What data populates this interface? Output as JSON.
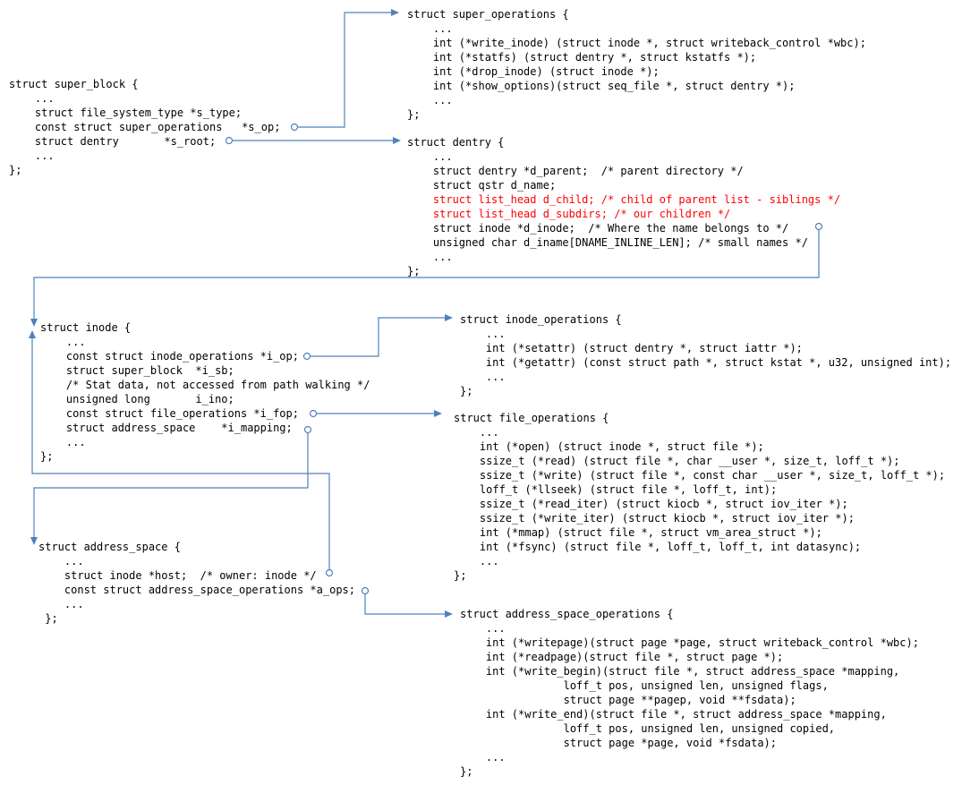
{
  "diagram": {
    "blocks": [
      {
        "id": "super_block",
        "lines": [
          {
            "text": "struct super_block {"
          },
          {
            "text": "    ..."
          },
          {
            "text": "    struct file_system_type *s_type;"
          },
          {
            "text": "    const struct super_operations   *s_op;"
          },
          {
            "text": "    struct dentry       *s_root;"
          },
          {
            "text": "    ..."
          },
          {
            "text": "};"
          }
        ]
      },
      {
        "id": "super_operations",
        "lines": [
          {
            "text": "struct super_operations {"
          },
          {
            "text": "    ..."
          },
          {
            "text": "    int (*write_inode) (struct inode *, struct writeback_control *wbc);"
          },
          {
            "text": "    int (*statfs) (struct dentry *, struct kstatfs *);"
          },
          {
            "text": "    int (*drop_inode) (struct inode *);"
          },
          {
            "text": "    int (*show_options)(struct seq_file *, struct dentry *);"
          },
          {
            "text": "    ..."
          },
          {
            "text": "};"
          }
        ]
      },
      {
        "id": "dentry",
        "lines": [
          {
            "text": "struct dentry {"
          },
          {
            "text": "    ..."
          },
          {
            "text": "    struct dentry *d_parent;  /* parent directory */"
          },
          {
            "text": "    struct qstr d_name;"
          },
          {
            "text": "    struct list_head d_child; /* child of parent list - siblings */",
            "color": "#ff0000"
          },
          {
            "text": "    struct list_head d_subdirs; /* our children */",
            "color": "#ff0000"
          },
          {
            "text": "    struct inode *d_inode;  /* Where the name belongs to */"
          },
          {
            "text": "    unsigned char d_iname[DNAME_INLINE_LEN]; /* small names */"
          },
          {
            "text": "    ..."
          },
          {
            "text": "};"
          }
        ]
      },
      {
        "id": "inode",
        "lines": [
          {
            "text": "struct inode {"
          },
          {
            "text": "    ..."
          },
          {
            "text": "    const struct inode_operations *i_op;"
          },
          {
            "text": "    struct super_block  *i_sb;"
          },
          {
            "text": "    /* Stat data, not accessed from path walking */"
          },
          {
            "text": "    unsigned long       i_ino;"
          },
          {
            "text": "    const struct file_operations *i_fop;"
          },
          {
            "text": "    struct address_space    *i_mapping;"
          },
          {
            "text": "    ..."
          },
          {
            "text": "};"
          }
        ]
      },
      {
        "id": "inode_operations",
        "lines": [
          {
            "text": "struct inode_operations {"
          },
          {
            "text": "    ..."
          },
          {
            "text": "    int (*setattr) (struct dentry *, struct iattr *);"
          },
          {
            "text": "    int (*getattr) (const struct path *, struct kstat *, u32, unsigned int);"
          },
          {
            "text": "    ..."
          },
          {
            "text": "};"
          }
        ]
      },
      {
        "id": "file_operations",
        "lines": [
          {
            "text": "struct file_operations {"
          },
          {
            "text": "    ..."
          },
          {
            "text": "    int (*open) (struct inode *, struct file *);"
          },
          {
            "text": "    ssize_t (*read) (struct file *, char __user *, size_t, loff_t *);"
          },
          {
            "text": "    ssize_t (*write) (struct file *, const char __user *, size_t, loff_t *);"
          },
          {
            "text": "    loff_t (*llseek) (struct file *, loff_t, int);"
          },
          {
            "text": "    ssize_t (*read_iter) (struct kiocb *, struct iov_iter *);"
          },
          {
            "text": "    ssize_t (*write_iter) (struct kiocb *, struct iov_iter *);"
          },
          {
            "text": "    int (*mmap) (struct file *, struct vm_area_struct *);"
          },
          {
            "text": "    int (*fsync) (struct file *, loff_t, loff_t, int datasync);"
          },
          {
            "text": "    ..."
          },
          {
            "text": "};"
          }
        ]
      },
      {
        "id": "address_space",
        "lines": [
          {
            "text": "struct address_space {"
          },
          {
            "text": "    ..."
          },
          {
            "text": "    struct inode *host;  /* owner: inode */"
          },
          {
            "text": "    const struct address_space_operations *a_ops;"
          },
          {
            "text": "    ..."
          },
          {
            "text": " };"
          }
        ]
      },
      {
        "id": "address_space_operations",
        "lines": [
          {
            "text": "struct address_space_operations {"
          },
          {
            "text": "    ..."
          },
          {
            "text": "    int (*writepage)(struct page *page, struct writeback_control *wbc);"
          },
          {
            "text": "    int (*readpage)(struct file *, struct page *);"
          },
          {
            "text": "    int (*write_begin)(struct file *, struct address_space *mapping,"
          },
          {
            "text": "                loff_t pos, unsigned len, unsigned flags,"
          },
          {
            "text": "                struct page **pagep, void **fsdata);"
          },
          {
            "text": "    int (*write_end)(struct file *, struct address_space *mapping,"
          },
          {
            "text": "                loff_t pos, unsigned len, unsigned copied,"
          },
          {
            "text": "                struct page *page, void *fsdata);"
          },
          {
            "text": "    ..."
          },
          {
            "text": "};"
          }
        ]
      }
    ],
    "connections": [
      {
        "from": "super_block.s_op",
        "to": "super_operations"
      },
      {
        "from": "super_block.s_root",
        "to": "dentry"
      },
      {
        "from": "dentry.d_inode",
        "to": "inode"
      },
      {
        "from": "inode.i_op",
        "to": "inode_operations"
      },
      {
        "from": "inode.i_fop",
        "to": "file_operations"
      },
      {
        "from": "inode.i_mapping",
        "to": "address_space"
      },
      {
        "from": "address_space.host",
        "to": "inode"
      },
      {
        "from": "address_space.a_ops",
        "to": "address_space_operations"
      }
    ],
    "colors": {
      "connector": "#4f81bd",
      "highlight": "#ff0000",
      "text": "#000000"
    }
  }
}
